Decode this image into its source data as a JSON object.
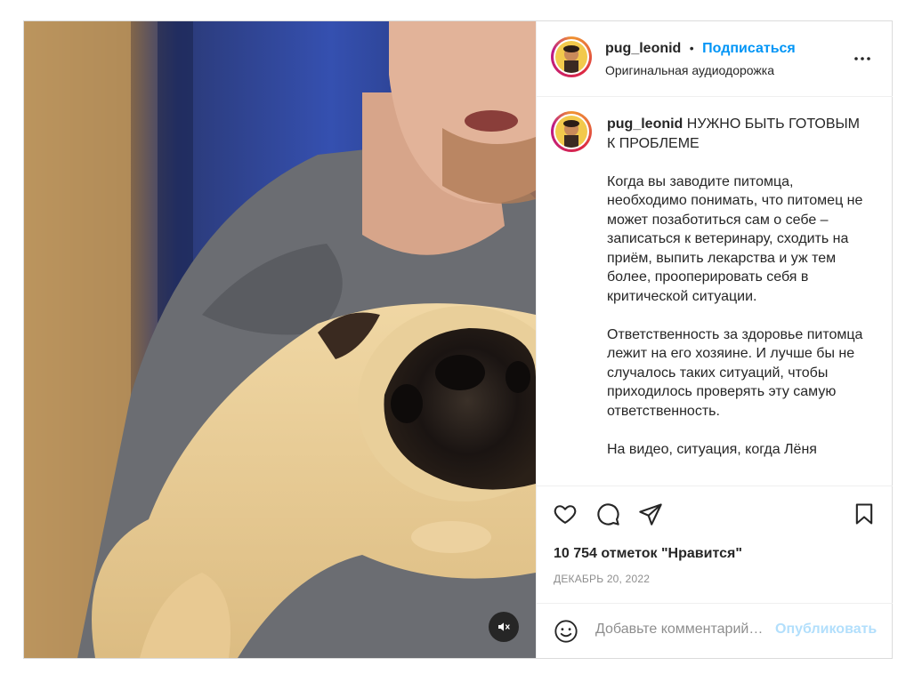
{
  "post": {
    "username": "pug_leonid",
    "dot": "•",
    "follow_label": "Подписаться",
    "audio_label": "Оригинальная аудиодорожка",
    "caption_title": "НУЖНО БЫТЬ ГОТОВЫМ К ПРОБЛЕМЕ",
    "caption_paragraphs": [
      "Когда вы заводите питомца, необходимо понимать, что питомец не может позаботиться сам о себе – записаться к ветеринару, сходить на приём, выпить лекарства и уж тем более, прооперировать себя в критической ситуации.",
      "Ответственность за здоровье питомца лежит на его хозяине. И лучше бы не случалось таких ситуаций, чтобы приходилось проверять эту самую ответственность.",
      "На видео, ситуация, когда Лёня"
    ],
    "likes": "10 754 отметок \"Нравится\"",
    "date": "ДЕКАБРЬ 20, 2022"
  },
  "comment": {
    "placeholder": "Добавьте комментарий…",
    "post_label": "Опубликовать"
  },
  "icons": {
    "more": "more-options-icon",
    "like": "heart-icon",
    "comment": "comment-icon",
    "share": "share-icon",
    "save": "bookmark-icon",
    "emoji": "emoji-icon",
    "mute": "muted-speaker-icon"
  },
  "colors": {
    "link": "#0095f6",
    "post_disabled": "#b2dffc",
    "muted_text": "#8e8e8e"
  }
}
